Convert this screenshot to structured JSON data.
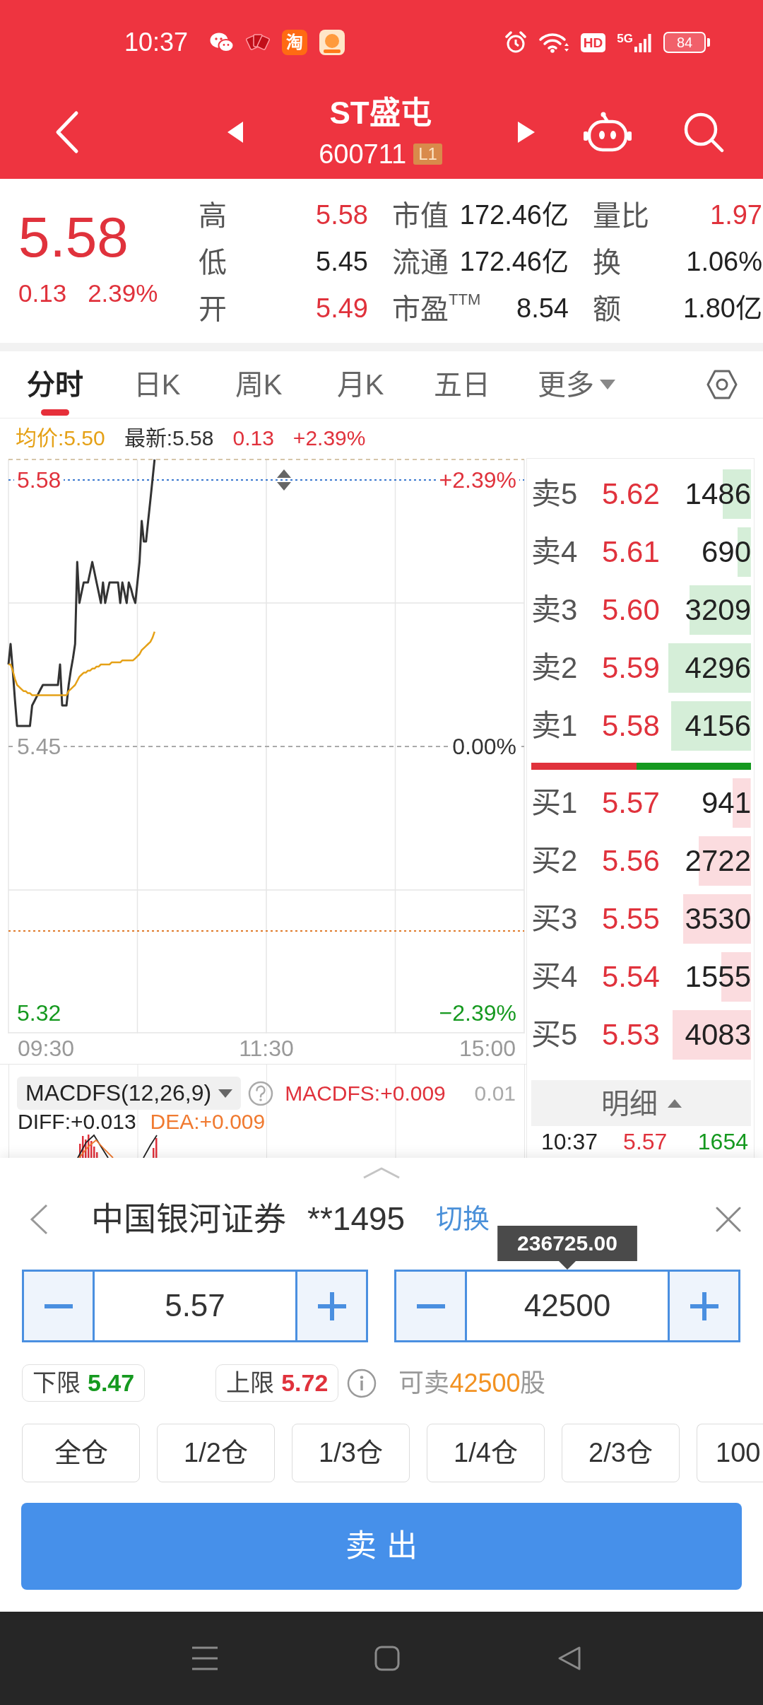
{
  "status_bar": {
    "time": "10:37",
    "app_label": "淘",
    "hd": "HD",
    "network": "5G",
    "battery": "84"
  },
  "header": {
    "title": "ST盛屯",
    "code": "600711",
    "tier": "L1"
  },
  "quote": {
    "price": "5.58",
    "change": "0.13",
    "change_pct": "2.39%",
    "rising": true,
    "stats": [
      {
        "label": "高",
        "value": "5.58",
        "color": "#e0323c"
      },
      {
        "label": "市值",
        "value": "172.46亿",
        "color": "#222222"
      },
      {
        "label": "量比",
        "value": "1.97",
        "color": "#e0323c"
      },
      {
        "label": "低",
        "value": "5.45",
        "color": "#222222"
      },
      {
        "label": "流通",
        "value": "172.46亿",
        "color": "#222222"
      },
      {
        "label": "换",
        "value": "1.06%",
        "color": "#222222"
      },
      {
        "label": "开",
        "value": "5.49",
        "color": "#e0323c"
      },
      {
        "label": "市盈$^{TTM}$",
        "value": "8.54",
        "color": "#222222"
      },
      {
        "label": "额",
        "value": "1.80亿",
        "color": "#222222"
      }
    ]
  },
  "tabs": [
    {
      "label": "分时",
      "selected": true,
      "kind": "tab"
    },
    {
      "label": "日K",
      "selected": false,
      "kind": "tab"
    },
    {
      "label": "周K",
      "selected": false,
      "kind": "tab"
    },
    {
      "label": "月K",
      "selected": false,
      "kind": "tab"
    },
    {
      "label": "五日",
      "selected": false,
      "kind": "tab"
    },
    {
      "label": "更多",
      "selected": false,
      "kind": "menu"
    }
  ],
  "chart_info": {
    "avg": "均价:5.50",
    "latest": "最新:5.58",
    "change": "0.13",
    "change_pct": "+2.39%"
  },
  "price_chart": {
    "pct_labels": [
      "+2.39%",
      "0.00%",
      "−2.39%"
    ],
    "time_labels": [
      "09:30",
      "11:30",
      "15:00"
    ],
    "chart_data": {
      "type": "line",
      "categories": [
        null,
        null,
        null,
        null,
        null,
        null,
        null,
        null,
        null,
        null,
        null,
        null,
        null,
        null,
        null,
        null,
        null,
        null,
        null,
        null,
        null,
        null,
        null,
        null,
        null,
        null,
        null,
        null,
        null,
        null,
        null,
        null,
        null,
        null,
        null,
        null,
        null,
        null,
        null,
        null,
        null,
        null,
        null,
        null,
        null,
        null,
        null,
        null,
        null,
        null,
        null,
        null,
        null,
        null,
        null,
        null,
        null,
        null,
        null,
        null,
        null,
        null,
        null,
        null,
        null,
        null,
        null,
        null,
        null,
        null,
        null,
        null,
        null,
        null,
        null,
        null,
        null,
        null,
        null,
        null,
        null,
        null,
        null,
        null,
        null,
        null,
        null,
        null,
        null,
        null,
        null,
        null,
        null,
        null,
        null,
        null,
        null,
        null,
        null,
        null,
        null,
        null,
        null,
        null,
        null,
        null,
        null,
        null,
        null,
        null,
        null,
        null,
        null,
        null,
        null,
        null,
        null,
        null,
        null,
        null,
        null,
        null,
        null,
        null,
        null,
        null,
        null,
        null,
        null,
        null,
        null,
        null,
        null,
        null,
        null,
        null,
        null,
        null,
        null,
        null,
        null,
        null,
        null,
        null,
        null,
        null,
        null,
        null,
        null,
        null,
        null,
        null,
        null,
        null,
        null,
        null,
        null,
        null,
        null,
        null,
        null,
        null,
        null,
        null,
        null,
        null,
        null,
        null,
        null,
        null,
        null,
        null,
        null,
        null,
        null,
        null,
        null,
        null,
        null,
        null,
        null,
        null,
        null,
        null,
        null,
        null,
        null,
        null,
        null,
        null,
        null,
        null,
        null,
        null,
        null,
        null,
        null,
        null,
        null,
        null,
        null,
        null,
        null,
        null,
        null,
        null,
        null,
        null,
        null,
        null,
        null,
        null,
        null,
        null,
        null,
        null,
        null,
        null,
        null,
        null,
        null,
        null,
        null,
        null,
        null,
        null,
        null,
        null,
        null,
        null,
        null,
        null,
        null,
        null,
        null,
        null,
        null,
        null,
        null,
        null,
        null
      ],
      "ylim": [
        5.31,
        5.59
      ],
      "yticks": [
        {
          "value": 5.58,
          "label": "5.58"
        },
        {
          "value": 5.45,
          "label": "5.45"
        },
        {
          "value": 5.32,
          "label": "5.32"
        }
      ],
      "series": [
        {
          "color": "#333333",
          "values": [
            5.49,
            5.5,
            5.487,
            5.473,
            5.46,
            5.46,
            5.46,
            5.46,
            5.46,
            5.46,
            5.46,
            5.47,
            5.472,
            5.474,
            5.476,
            5.478,
            5.48,
            5.48,
            5.48,
            5.48,
            5.48,
            5.48,
            5.48,
            5.48,
            5.49,
            5.47,
            5.47,
            5.47,
            5.48,
            5.487,
            5.493,
            5.5,
            5.54,
            5.52,
            5.525,
            5.53,
            5.53,
            5.53,
            5.535,
            5.54,
            5.535,
            5.53,
            5.525,
            5.52,
            5.53,
            5.52,
            5.525,
            5.53,
            5.53,
            5.53,
            5.53,
            5.53,
            5.52,
            5.53,
            5.525,
            5.52,
            5.53,
            5.527,
            5.523,
            5.52,
            5.53,
            5.54,
            5.56,
            5.55,
            5.55,
            5.56,
            5.57,
            5.58,
            5.59,
            null,
            null,
            null,
            null,
            null,
            null,
            null,
            null,
            null,
            null,
            null,
            null,
            null,
            null,
            null,
            null,
            null,
            null,
            null,
            null,
            null,
            null,
            null,
            null,
            null,
            null,
            null,
            null,
            null,
            null,
            null,
            null,
            null,
            null,
            null,
            null,
            null,
            null,
            null,
            null,
            null,
            null,
            null,
            null,
            null,
            null,
            null,
            null,
            null,
            null,
            null,
            null,
            null,
            null,
            null,
            null,
            null,
            null,
            null,
            null,
            null,
            null,
            null,
            null,
            null,
            null,
            null,
            null,
            null,
            null,
            null,
            null,
            null,
            null,
            null,
            null,
            null,
            null,
            null,
            null,
            null,
            null,
            null,
            null,
            null,
            null,
            null,
            null,
            null,
            null,
            null,
            null,
            null,
            null,
            null,
            null,
            null,
            null,
            null,
            null,
            null,
            null,
            null,
            null,
            null,
            null,
            null,
            null,
            null,
            null,
            null,
            null,
            null,
            null,
            null,
            null,
            null,
            null,
            null,
            null,
            null,
            null,
            null,
            null,
            null,
            null,
            null,
            null,
            null,
            null,
            null,
            null,
            null,
            null,
            null,
            null,
            null,
            null,
            null,
            null,
            null,
            null,
            null,
            null,
            null,
            null,
            null,
            null,
            null,
            null,
            null,
            null,
            null,
            null,
            null,
            null,
            null,
            null,
            null,
            null,
            null,
            null,
            null,
            null,
            null,
            null,
            null,
            null,
            null,
            null,
            null,
            null
          ]
        },
        {
          "color": "#e5a117",
          "values": [
            5.49,
            5.49,
            5.487,
            5.483,
            5.48,
            5.479,
            5.478,
            5.477,
            5.477,
            5.476,
            5.476,
            5.475,
            5.475,
            5.475,
            5.475,
            5.475,
            5.475,
            5.475,
            5.475,
            5.475,
            5.475,
            5.475,
            5.475,
            5.475,
            5.475,
            5.475,
            5.475,
            5.475,
            5.477,
            5.478,
            5.479,
            5.48,
            5.482,
            5.484,
            5.485,
            5.486,
            5.486,
            5.487,
            5.487,
            5.488,
            5.488,
            5.489,
            5.489,
            5.49,
            5.49,
            5.49,
            5.49,
            5.49,
            5.491,
            5.491,
            5.491,
            5.491,
            5.491,
            5.492,
            5.492,
            5.492,
            5.492,
            5.492,
            5.492,
            5.493,
            5.494,
            5.495,
            5.497,
            5.498,
            5.499,
            5.5,
            5.501,
            5.503,
            5.506,
            null,
            null,
            null,
            null,
            null,
            null,
            null,
            null,
            null,
            null,
            null,
            null,
            null,
            null,
            null,
            null,
            null,
            null,
            null,
            null,
            null,
            null,
            null,
            null,
            null,
            null,
            null,
            null,
            null,
            null,
            null,
            null,
            null,
            null,
            null,
            null,
            null,
            null,
            null,
            null,
            null,
            null,
            null,
            null,
            null,
            null,
            null,
            null,
            null,
            null,
            null,
            null,
            null,
            null,
            null,
            null,
            null,
            null,
            null,
            null,
            null,
            null,
            null,
            null,
            null,
            null,
            null,
            null,
            null,
            null,
            null,
            null,
            null,
            null,
            null,
            null,
            null,
            null,
            null,
            null,
            null,
            null,
            null,
            null,
            null,
            null,
            null,
            null,
            null,
            null,
            null,
            null,
            null,
            null,
            null,
            null,
            null,
            null,
            null,
            null,
            null,
            null,
            null,
            null,
            null,
            null,
            null,
            null,
            null,
            null,
            null,
            null,
            null,
            null,
            null,
            null,
            null,
            null,
            null,
            null,
            null,
            null,
            null,
            null,
            null,
            null,
            null,
            null,
            null,
            null,
            null,
            null,
            null,
            null,
            null,
            null,
            null,
            null,
            null,
            null,
            null,
            null,
            null,
            null,
            null,
            null,
            null,
            null,
            null,
            null,
            null,
            null,
            null,
            null,
            null,
            null,
            null,
            null,
            null,
            null,
            null,
            null,
            null,
            null,
            null,
            null,
            null,
            null,
            null,
            null,
            null,
            null
          ]
        }
      ],
      "ref_lines": [
        {
          "axis": "y",
          "value": 5.58
        },
        {
          "axis": "y",
          "value": 5.45
        },
        {
          "axis": "y",
          "value": 5.36
        }
      ]
    }
  },
  "macd": {
    "indicator": "MACDFS(12,26,9)",
    "value": "MACDFS:+0.009",
    "axis_label": "0.01",
    "diff": "DIFF:+0.013",
    "dea": "DEA:+0.009"
  },
  "order_book": {
    "asks": [
      {
        "label": "卖5",
        "price": "5.62",
        "volume": "1486"
      },
      {
        "label": "卖4",
        "price": "5.61",
        "volume": "690"
      },
      {
        "label": "卖3",
        "price": "5.60",
        "volume": "3209"
      },
      {
        "label": "卖2",
        "price": "5.59",
        "volume": "4296"
      },
      {
        "label": "卖1",
        "price": "5.58",
        "volume": "4156"
      }
    ],
    "ratio": {
      "level": 0.48
    },
    "bids": [
      {
        "label": "买1",
        "price": "5.57",
        "volume": "941"
      },
      {
        "label": "买2",
        "price": "5.56",
        "volume": "2722"
      },
      {
        "label": "买3",
        "price": "5.55",
        "volume": "3530"
      },
      {
        "label": "买4",
        "price": "5.54",
        "volume": "1555"
      },
      {
        "label": "买5",
        "price": "5.53",
        "volume": "4083"
      }
    ],
    "detail_button": "明细",
    "trades": [
      {
        "time": "10:37",
        "price": "5.57",
        "volume": "1654",
        "kind": "sell"
      }
    ]
  },
  "trade_panel": {
    "broker": "中国银河证券",
    "account": "**1495",
    "switch": "切换",
    "price": "5.57",
    "quantity": "42500",
    "amount_tooltip": "236725.00",
    "limits": [
      {
        "kind": "lower",
        "label": "下限",
        "value": "5.47"
      },
      {
        "kind": "upper",
        "label": "上限",
        "value": "5.72"
      }
    ],
    "sellable": {
      "label": "可卖",
      "quantity": "42500",
      "unit": "股"
    },
    "portions": [
      "全仓",
      "1/2仓",
      "1/3仓",
      "1/4仓",
      "2/3仓",
      "100"
    ],
    "submit": "卖出"
  }
}
